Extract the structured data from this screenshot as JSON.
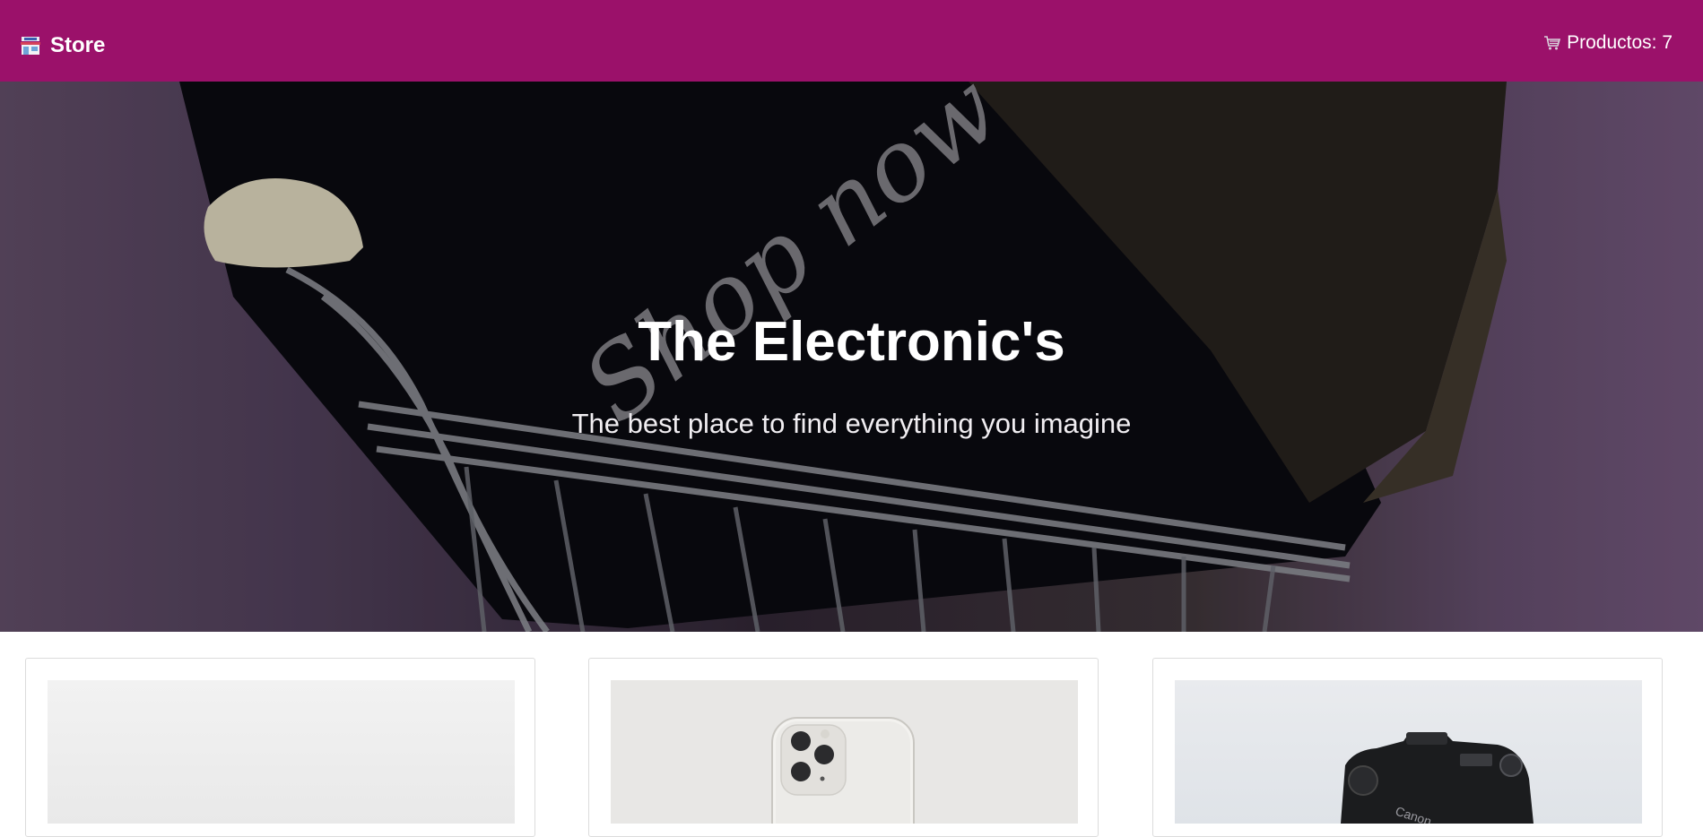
{
  "navbar": {
    "brand": {
      "icon": "store-icon",
      "label": "Store"
    },
    "cart": {
      "icon": "cart-icon",
      "label": "Productos: 7"
    }
  },
  "hero": {
    "title": "The Electronic's",
    "subtitle": "The best place to find everything you imagine",
    "background_text": "Shop now"
  },
  "products": [
    {
      "image": "product-image-light"
    },
    {
      "image": "iphone-image"
    },
    {
      "image": "canon-camera-image"
    }
  ],
  "colors": {
    "navbar": "#9b116a",
    "hero_base": "#4b3d55"
  }
}
